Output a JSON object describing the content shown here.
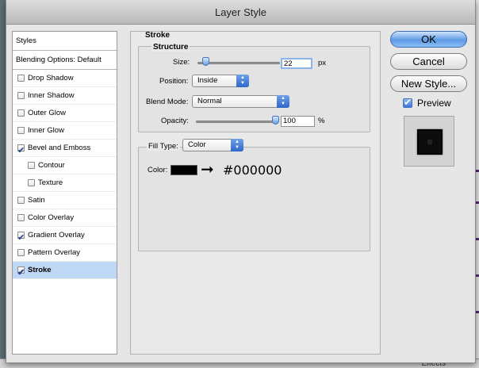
{
  "window": {
    "title": "Layer Style"
  },
  "styles_list": {
    "header": "Styles",
    "blending": "Blending Options: Default",
    "items": [
      {
        "label": "Drop Shadow",
        "checked": false,
        "indent": false,
        "selected": false
      },
      {
        "label": "Inner Shadow",
        "checked": false,
        "indent": false,
        "selected": false
      },
      {
        "label": "Outer Glow",
        "checked": false,
        "indent": false,
        "selected": false
      },
      {
        "label": "Inner Glow",
        "checked": false,
        "indent": false,
        "selected": false
      },
      {
        "label": "Bevel and Emboss",
        "checked": true,
        "indent": false,
        "selected": false
      },
      {
        "label": "Contour",
        "checked": false,
        "indent": true,
        "selected": false
      },
      {
        "label": "Texture",
        "checked": false,
        "indent": true,
        "selected": false
      },
      {
        "label": "Satin",
        "checked": false,
        "indent": false,
        "selected": false
      },
      {
        "label": "Color Overlay",
        "checked": false,
        "indent": false,
        "selected": false
      },
      {
        "label": "Gradient Overlay",
        "checked": true,
        "indent": false,
        "selected": false
      },
      {
        "label": "Pattern Overlay",
        "checked": false,
        "indent": false,
        "selected": false
      },
      {
        "label": "Stroke",
        "checked": true,
        "indent": false,
        "selected": true
      }
    ]
  },
  "stroke": {
    "section_title": "Stroke",
    "structure_title": "Structure",
    "size_label": "Size:",
    "size_value": "22",
    "size_unit": "px",
    "size_slider_fraction": 0.1,
    "position_label": "Position:",
    "position_value": "Inside",
    "blend_label": "Blend Mode:",
    "blend_value": "Normal",
    "opacity_label": "Opacity:",
    "opacity_value": "100",
    "opacity_unit": "%",
    "opacity_slider_fraction": 1.0,
    "fill_type_label": "Fill Type:",
    "fill_type_value": "Color",
    "color_label": "Color:",
    "color_value": "#000000",
    "color_hex_text": "#000000"
  },
  "buttons": {
    "ok": "OK",
    "cancel": "Cancel",
    "new_style": "New Style..."
  },
  "preview": {
    "label": "Preview",
    "checked": true
  },
  "backdrop": {
    "effects_label": "Effects"
  }
}
